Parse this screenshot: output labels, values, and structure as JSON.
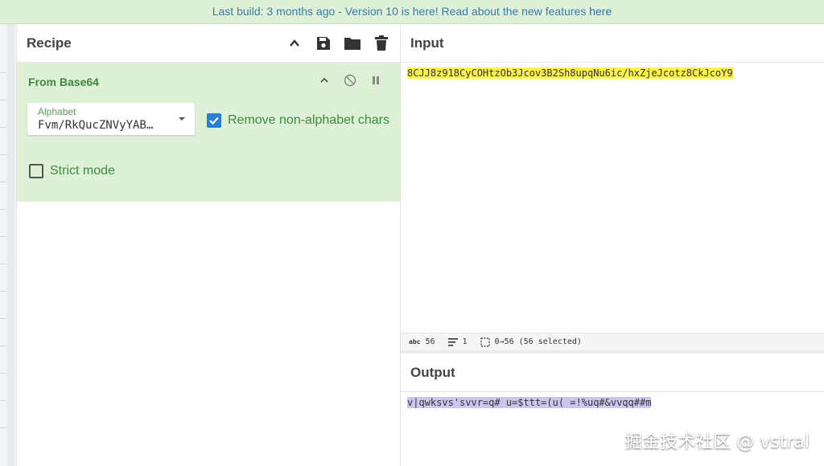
{
  "banner": {
    "prefix": "Last build: 3 months ago - Version 10 is here! Read about the new features ",
    "link": "here"
  },
  "recipe": {
    "title": "Recipe",
    "icons": [
      "chevron-up-icon",
      "save-icon",
      "folder-icon",
      "trash-icon"
    ],
    "operation": {
      "name": "From Base64",
      "alphabet_label": "Alphabet",
      "alphabet_value": "Fvm/RkQucZNVyYAB…",
      "remove_non_alphabet_label": "Remove non-alphabet chars",
      "remove_non_alphabet_checked": true,
      "strict_mode_label": "Strict mode",
      "strict_mode_checked": false
    }
  },
  "input": {
    "title": "Input",
    "text": "8CJJ8z918CyCOHtzOb3Jcov3B2Sh8upqNu6ic/hxZjeJcotz8CkJcoY9"
  },
  "status": {
    "length": "56",
    "lines": "1",
    "selection": "0→56 (56 selected)"
  },
  "output": {
    "title": "Output",
    "text": "v|qwksvs'svvr=q# u=$ttt=(u( =!%uq#&vvqq##m"
  },
  "watermark": "掘金技术社区 @ vstral",
  "colors": {
    "banner_bg": "#dff0d8",
    "operation_bg": "#dff0d8",
    "input_highlight": "#fff14d",
    "output_highlight": "#cdc6ec",
    "checkbox": "#2a7fd4"
  }
}
